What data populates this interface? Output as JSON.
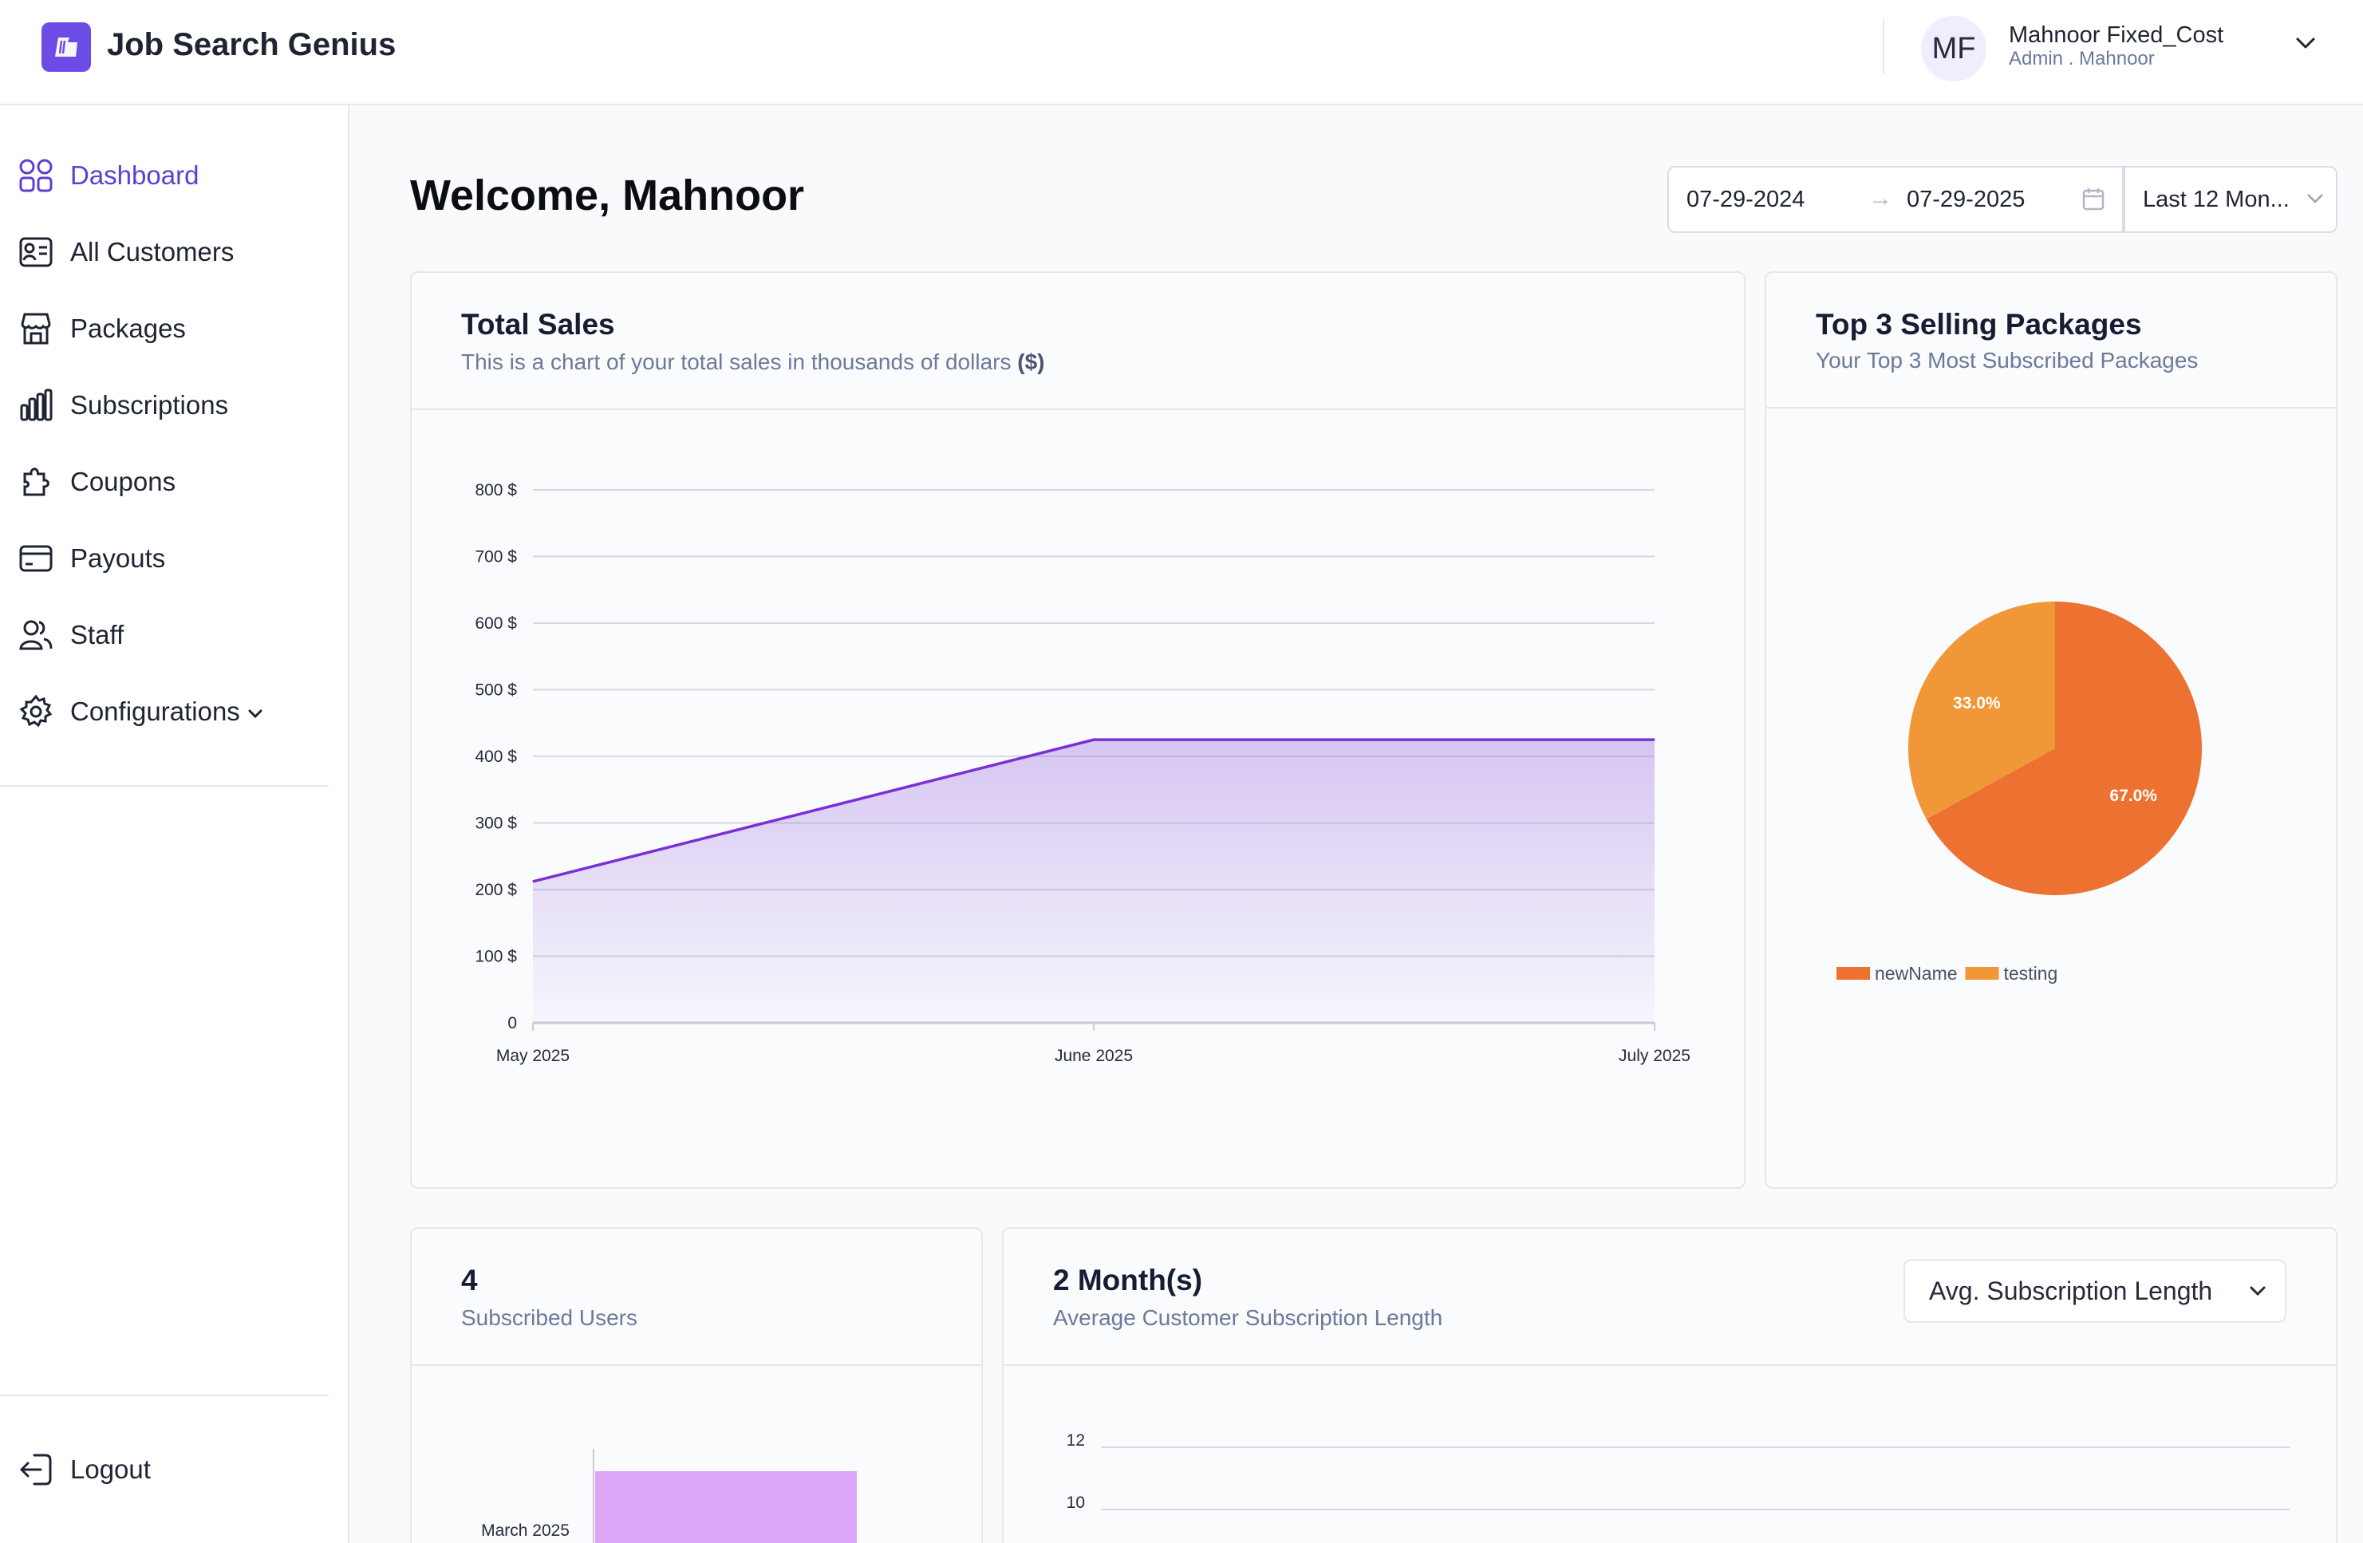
{
  "app": {
    "title": "Job Search Genius"
  },
  "user": {
    "initials": "MF",
    "name": "Mahnoor Fixed_Cost",
    "role": "Admin . Mahnoor"
  },
  "sidebar": {
    "items": [
      {
        "label": "Dashboard",
        "icon": "grid-icon",
        "active": true
      },
      {
        "label": "All Customers",
        "icon": "id-card-icon"
      },
      {
        "label": "Packages",
        "icon": "store-icon"
      },
      {
        "label": "Subscriptions",
        "icon": "bar-chart-icon"
      },
      {
        "label": "Coupons",
        "icon": "puzzle-icon"
      },
      {
        "label": "Payouts",
        "icon": "credit-card-icon"
      },
      {
        "label": "Staff",
        "icon": "users-icon"
      },
      {
        "label": "Configurations",
        "icon": "gear-icon"
      }
    ],
    "logout": "Logout"
  },
  "main": {
    "welcome": "Welcome, Mahnoor",
    "date_from": "07-29-2024",
    "date_to": "07-29-2025",
    "period": "Last 12 Mon..."
  },
  "cards": {
    "sales": {
      "title": "Total Sales",
      "subtitle": "This is a chart of your total sales in thousands of dollars ",
      "subtitle_bold": "($)"
    },
    "packages": {
      "title": "Top 3 Selling Packages",
      "subtitle": "Your Top 3 Most Subscribed Packages"
    },
    "users": {
      "title": "4",
      "subtitle": "Subscribed Users"
    },
    "subs_length": {
      "title": "2 Month(s)",
      "subtitle": "Average Customer Subscription Length",
      "dropdown": "Avg. Subscription Length"
    }
  },
  "colors": {
    "accent": "#5b3fd6",
    "line": "#7b2fd6",
    "pie1": "#ed7130",
    "pie2": "#f09838",
    "bar": "#dda6f7"
  },
  "chart_data": [
    {
      "type": "area",
      "title": "Total Sales",
      "categories": [
        "May 2025",
        "June 2025",
        "July 2025"
      ],
      "values": [
        212,
        425,
        425
      ],
      "yticks": [
        "0",
        "100 $",
        "200 $",
        "300 $",
        "400 $",
        "500 $",
        "600 $",
        "700 $",
        "800 $"
      ],
      "ylim": [
        0,
        800
      ]
    },
    {
      "type": "pie",
      "title": "Top 3 Selling Packages",
      "labels": [
        "newName",
        "testing"
      ],
      "values": [
        67.0,
        33.0
      ],
      "data_labels": [
        "67.0%",
        "33.0%"
      ]
    },
    {
      "type": "bar",
      "orientation": "horizontal",
      "categories": [
        "March 2025"
      ]
    },
    {
      "type": "line",
      "yticks": [
        "10",
        "12"
      ]
    }
  ]
}
